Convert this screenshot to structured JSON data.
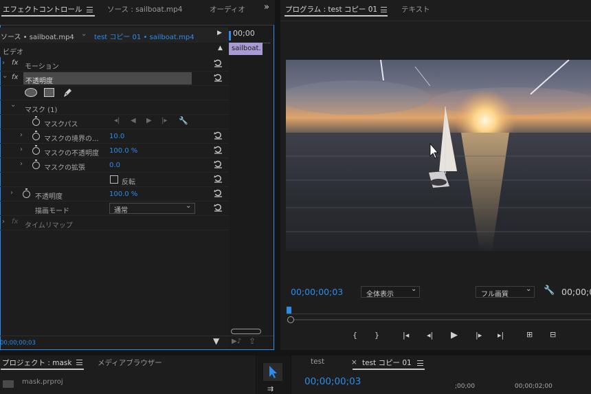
{
  "effect_panel": {
    "tabs": [
      "エフェクトコントロール",
      "ソース : sailboat.mp4",
      "オーディオ"
    ],
    "source_label": "ソース • sailboat.mp4",
    "seq_label": "test コピー 01 • sailboat.mp4",
    "timecode_head": "00;00",
    "clip_label": "sailboat.",
    "video_header": "ビデオ",
    "motion": "モーション",
    "opacity_section": "不透明度",
    "mask_name": "マスク (1)",
    "mask_path": "マスクパス",
    "mask_feather": "マスクの境界の...",
    "mask_feather_val": "10.0",
    "mask_opacity": "マスクの不透明度",
    "mask_opacity_val": "100.0 %",
    "mask_expansion": "マスクの拡張",
    "mask_expansion_val": "0.0",
    "invert": "反転",
    "opacity": "不透明度",
    "opacity_val": "100.0 %",
    "blend_mode": "描画モード",
    "blend_mode_val": "通常",
    "time_remap": "タイムリマップ",
    "timecode_bottom": "00;00;00;03"
  },
  "program": {
    "tabs": [
      "プログラム : test コピー 01",
      "テキスト"
    ],
    "timecode": "00;00;00;03",
    "zoom": "全体表示",
    "quality": "フル画質",
    "right_timecode": "00;00;0"
  },
  "project": {
    "tabs": [
      "プロジェクト : mask",
      "メディアブラウザー"
    ],
    "file": "mask.prproj"
  },
  "timeline": {
    "tabs": [
      "test",
      "test コピー 01"
    ],
    "close": "×",
    "timecode": "00;00;00;03",
    "ruler": [
      ";00;00",
      "00;00;02;00"
    ]
  },
  "colors": {
    "accent": "#2d8ceb",
    "clip": "#a99ad6",
    "panel": "#1d1d1d"
  }
}
